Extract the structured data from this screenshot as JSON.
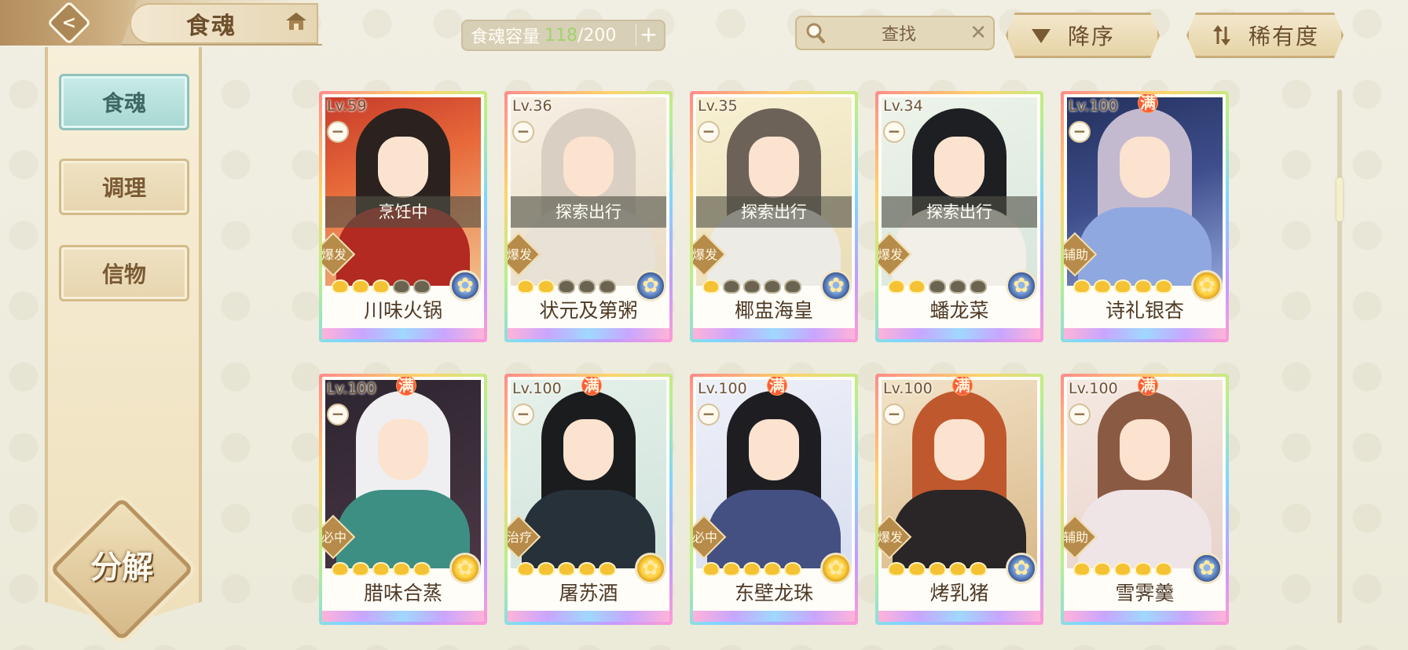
{
  "header": {
    "title": "食魂",
    "capacity": {
      "label": "食魂容量",
      "current": "118",
      "max": "/200",
      "plus": "+"
    },
    "search": {
      "value": "查找",
      "clear": "✕"
    },
    "sort_order_label": "降序",
    "sort_rarity_label": "稀有度"
  },
  "sidebar": {
    "tabs": [
      {
        "label": "食魂",
        "active": true
      },
      {
        "label": "调理",
        "active": false
      },
      {
        "label": "信物",
        "active": false
      }
    ],
    "decompose_label": "分解"
  },
  "cards": [
    {
      "level": "Lv.59",
      "max": "",
      "status": "烹饪中",
      "role": "爆发",
      "stars_filled": 3,
      "element": "blue",
      "name": "川味火锅"
    },
    {
      "level": "Lv.36",
      "max": "",
      "status": "探索出行",
      "role": "爆发",
      "stars_filled": 2,
      "element": "blue",
      "name": "状元及第粥"
    },
    {
      "level": "Lv.35",
      "max": "",
      "status": "探索出行",
      "role": "爆发",
      "stars_filled": 1,
      "element": "blue",
      "name": "椰盅海皇"
    },
    {
      "level": "Lv.34",
      "max": "",
      "status": "探索出行",
      "role": "爆发",
      "stars_filled": 2,
      "element": "blue",
      "name": "蟠龙菜"
    },
    {
      "level": "Lv.100",
      "max": "满",
      "status": "",
      "role": "辅助",
      "stars_filled": 5,
      "element": "gold",
      "name": "诗礼银杏"
    },
    {
      "level": "Lv.100",
      "max": "满",
      "status": "",
      "role": "必中",
      "stars_filled": 5,
      "element": "gold",
      "name": "腊味合蒸"
    },
    {
      "level": "Lv.100",
      "max": "满",
      "status": "",
      "role": "治疗",
      "stars_filled": 5,
      "element": "gold",
      "name": "屠苏酒"
    },
    {
      "level": "Lv.100",
      "max": "满",
      "status": "",
      "role": "必中",
      "stars_filled": 5,
      "element": "gold",
      "name": "东壁龙珠"
    },
    {
      "level": "Lv.100",
      "max": "满",
      "status": "",
      "role": "爆发",
      "stars_filled": 5,
      "element": "blue",
      "name": "烤乳猪"
    },
    {
      "level": "Lv.100",
      "max": "满",
      "status": "",
      "role": "辅助",
      "stars_filled": 5,
      "element": "blue",
      "name": "雪霁羹"
    }
  ],
  "colors": {
    "accent_teal": "#a7d8d2",
    "gold": "#f4c233",
    "capacity_current": "#9fd46a"
  }
}
